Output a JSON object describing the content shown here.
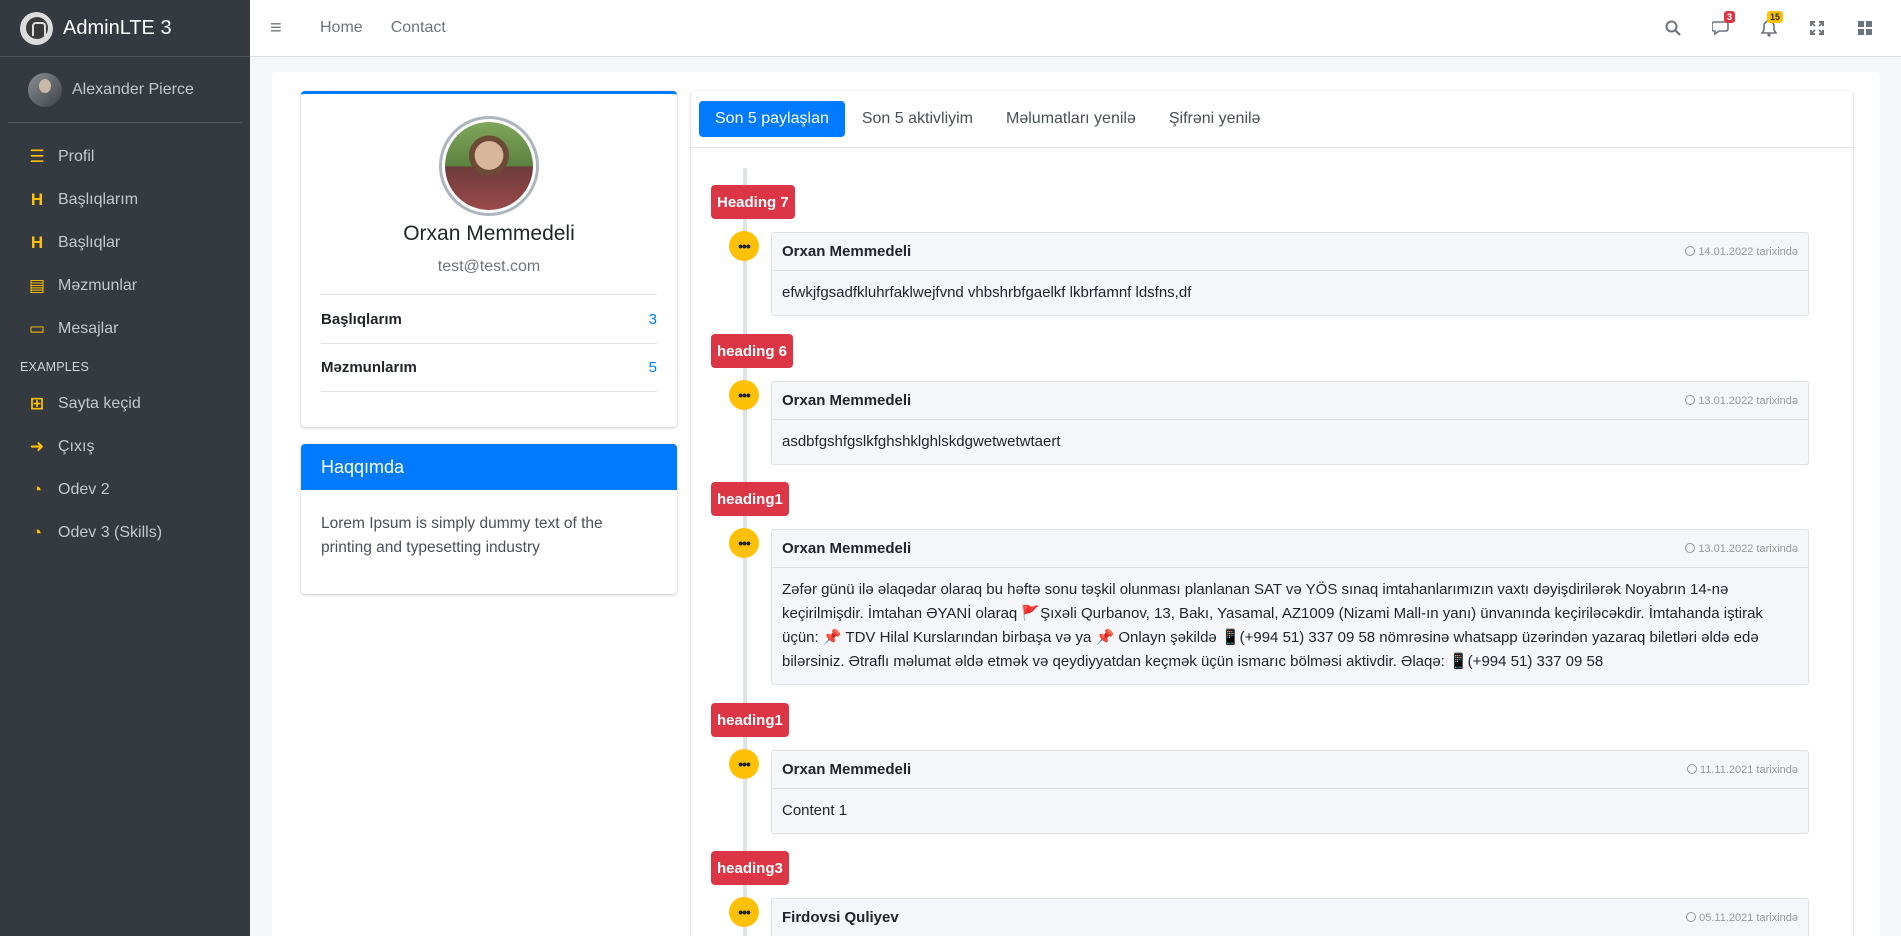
{
  "brand": {
    "name": "AdminLTE 3"
  },
  "user": {
    "name": "Alexander Pierce"
  },
  "sidebar": {
    "items": [
      {
        "label": "Profil",
        "icon": "list-icon"
      },
      {
        "label": "Başlıqlarım",
        "icon": "heading-icon"
      },
      {
        "label": "Başlıqlar",
        "icon": "heading-icon"
      },
      {
        "label": "Məzmunlar",
        "icon": "clipboard-icon"
      },
      {
        "label": "Mesajlar",
        "icon": "inbox-icon"
      }
    ],
    "section_header": "EXAMPLES",
    "examples": [
      {
        "label": "Sayta keçid",
        "icon": "sitemap-icon"
      },
      {
        "label": "Çıxış",
        "icon": "sign-out-icon"
      },
      {
        "label": "Odev 2",
        "icon": "tachometer-icon"
      },
      {
        "label": "Odev 3 (Skills)",
        "icon": "tachometer-icon"
      }
    ]
  },
  "navbar": {
    "links": [
      "Home",
      "Contact"
    ],
    "messages_badge": "3",
    "notifications_badge": "15"
  },
  "profile": {
    "name": "Orxan Memmedeli",
    "email": "test@test.com",
    "stats": [
      {
        "label": "Başlıqlarım",
        "value": "3"
      },
      {
        "label": "Məzmunlarım",
        "value": "5"
      }
    ]
  },
  "about": {
    "title": "Haqqımda",
    "text": "Lorem Ipsum is simply dummy text of the printing and typesetting industry"
  },
  "tabs": [
    "Son 5 paylaşlan",
    "Son 5 aktivliyim",
    "Məlumatları yenilə",
    "Şifrəni yenilə"
  ],
  "timeline": [
    {
      "heading": "Heading 7",
      "author": "Orxan Memmedeli",
      "time": "14.01.2022 tarixində",
      "content": "efwkjfgsadfkluhrfaklwejfvnd vhbshrbfgaelkf lkbrfamnf ldsfns,df"
    },
    {
      "heading": "heading 6",
      "author": "Orxan Memmedeli",
      "time": "13.01.2022 tarixində",
      "content": "asdbfgshfgslkfghshklghlskdgwetwetwtaert"
    },
    {
      "heading": "heading1",
      "author": "Orxan Memmedeli",
      "time": "13.01.2022 tarixində",
      "content": "Zəfər günü ilə əlaqədar olaraq bu həftə sonu təşkil olunması planlanan SAT və YÖS sınaq imtahanlarımızın vaxtı dəyişdirilərək Noyabrın 14-nə keçirilmişdir. İmtahan ƏYANİ olaraq 🚩Şıxəli Qurbanov, 13, Bakı, Yasamal, AZ1009 (Nizami Mall-ın yanı) ünvanında keçiriləcəkdir. İmtahanda iştirak üçün: 📌 TDV Hilal Kurslarından birbaşa və ya 📌 Onlayn şəkildə 📱(+994 51) 337 09 58 nömrəsinə whatsapp üzərindən yazaraq biletləri əldə edə bilərsiniz. Ətraflı məlumat əldə etmək və qeydiyyatdan keçmək üçün ismarıc bölməsi aktivdir. Əlaqə: 📱(+994 51) 337 09 58"
    },
    {
      "heading": "heading1",
      "author": "Orxan Memmedeli",
      "time": "11.11.2021 tarixində",
      "content": "Content 1"
    },
    {
      "heading": "heading3",
      "author": "Firdovsi Quliyev",
      "time": "05.11.2021 tarixində",
      "content": ""
    }
  ]
}
